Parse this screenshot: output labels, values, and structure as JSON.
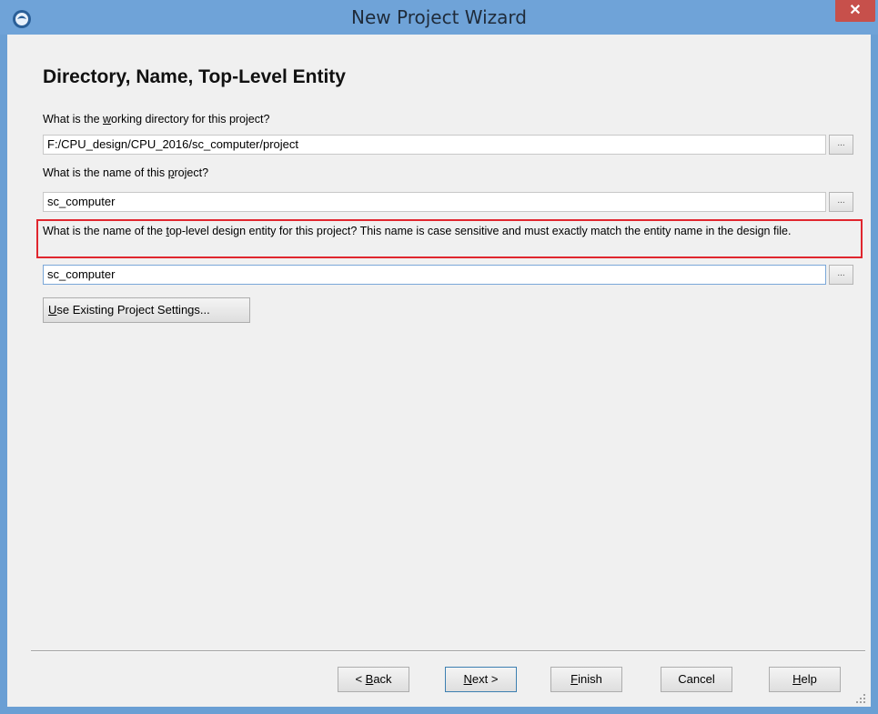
{
  "window": {
    "title": "New Project Wizard",
    "close_label": "✕",
    "icon": "app-logo-icon"
  },
  "page": {
    "title": "Directory, Name, Top-Level Entity"
  },
  "directory": {
    "label_pre": "What is the ",
    "label_accel": "w",
    "label_post": "orking directory for this project?",
    "value": "F:/CPU_design/CPU_2016/sc_computer/project",
    "browse_label": "..."
  },
  "project_name": {
    "label_pre": "What is the name of this ",
    "label_accel": "p",
    "label_post": "roject?",
    "value": "sc_computer",
    "browse_label": "..."
  },
  "top_level": {
    "label_pre": "What is the name of the ",
    "label_accel": "t",
    "label_post": "op-level design entity for this project? This name is case sensitive and must exactly match the entity name in the design file.",
    "value": "sc_computer",
    "browse_label": "...",
    "highlight_color": "#e0262e"
  },
  "existing_settings": {
    "accel": "U",
    "label_rest": "se Existing Project Settings..."
  },
  "footer": {
    "back": {
      "prefix": "< ",
      "accel": "B",
      "rest": "ack"
    },
    "next": {
      "accel": "N",
      "rest": "ext >"
    },
    "finish": {
      "accel": "F",
      "rest": "inish"
    },
    "cancel": {
      "label": "Cancel"
    },
    "help": {
      "accel": "H",
      "rest": "elp"
    }
  }
}
